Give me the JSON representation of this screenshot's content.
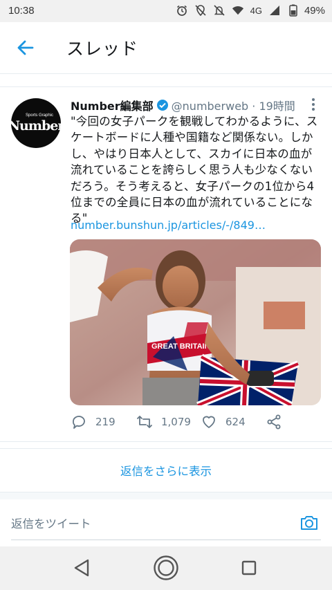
{
  "status_bar": {
    "time": "10:38",
    "network": "4G",
    "battery": "49%",
    "icons": [
      "alarm-icon",
      "location-off-icon",
      "mute-icon",
      "wifi-icon",
      "signal-icon",
      "battery-icon"
    ]
  },
  "header": {
    "title": "スレッド",
    "back_icon": "arrow-left-icon"
  },
  "tweet": {
    "avatar_text": "Number",
    "avatar_small_text": "Sports Graphic",
    "display_name": "Number編集部",
    "handle_time": "@numberweb · 19時間",
    "text": "\"今回の女子パークを観戦してわかるように、スケートボードに人種や国籍など関係ない。しかし、やはり日本人として、スカイに日本の血が流れていることを誇らしく思う人も少なくないだろう。そう考えると、女子パークの1位から4位までの全員に日本の血が流れていることになる\"",
    "link": "number.bunshun.jp/articles/-/849…",
    "image_caption_text": "GREAT BRITAIN",
    "actions": {
      "replies": "219",
      "retweets": "1,079",
      "likes": "624"
    }
  },
  "more_replies": "返信をさらに表示",
  "reply_placeholder": "返信をツイート",
  "colors": {
    "accent": "#1b95e0",
    "muted": "#657786",
    "text": "#14171a"
  }
}
